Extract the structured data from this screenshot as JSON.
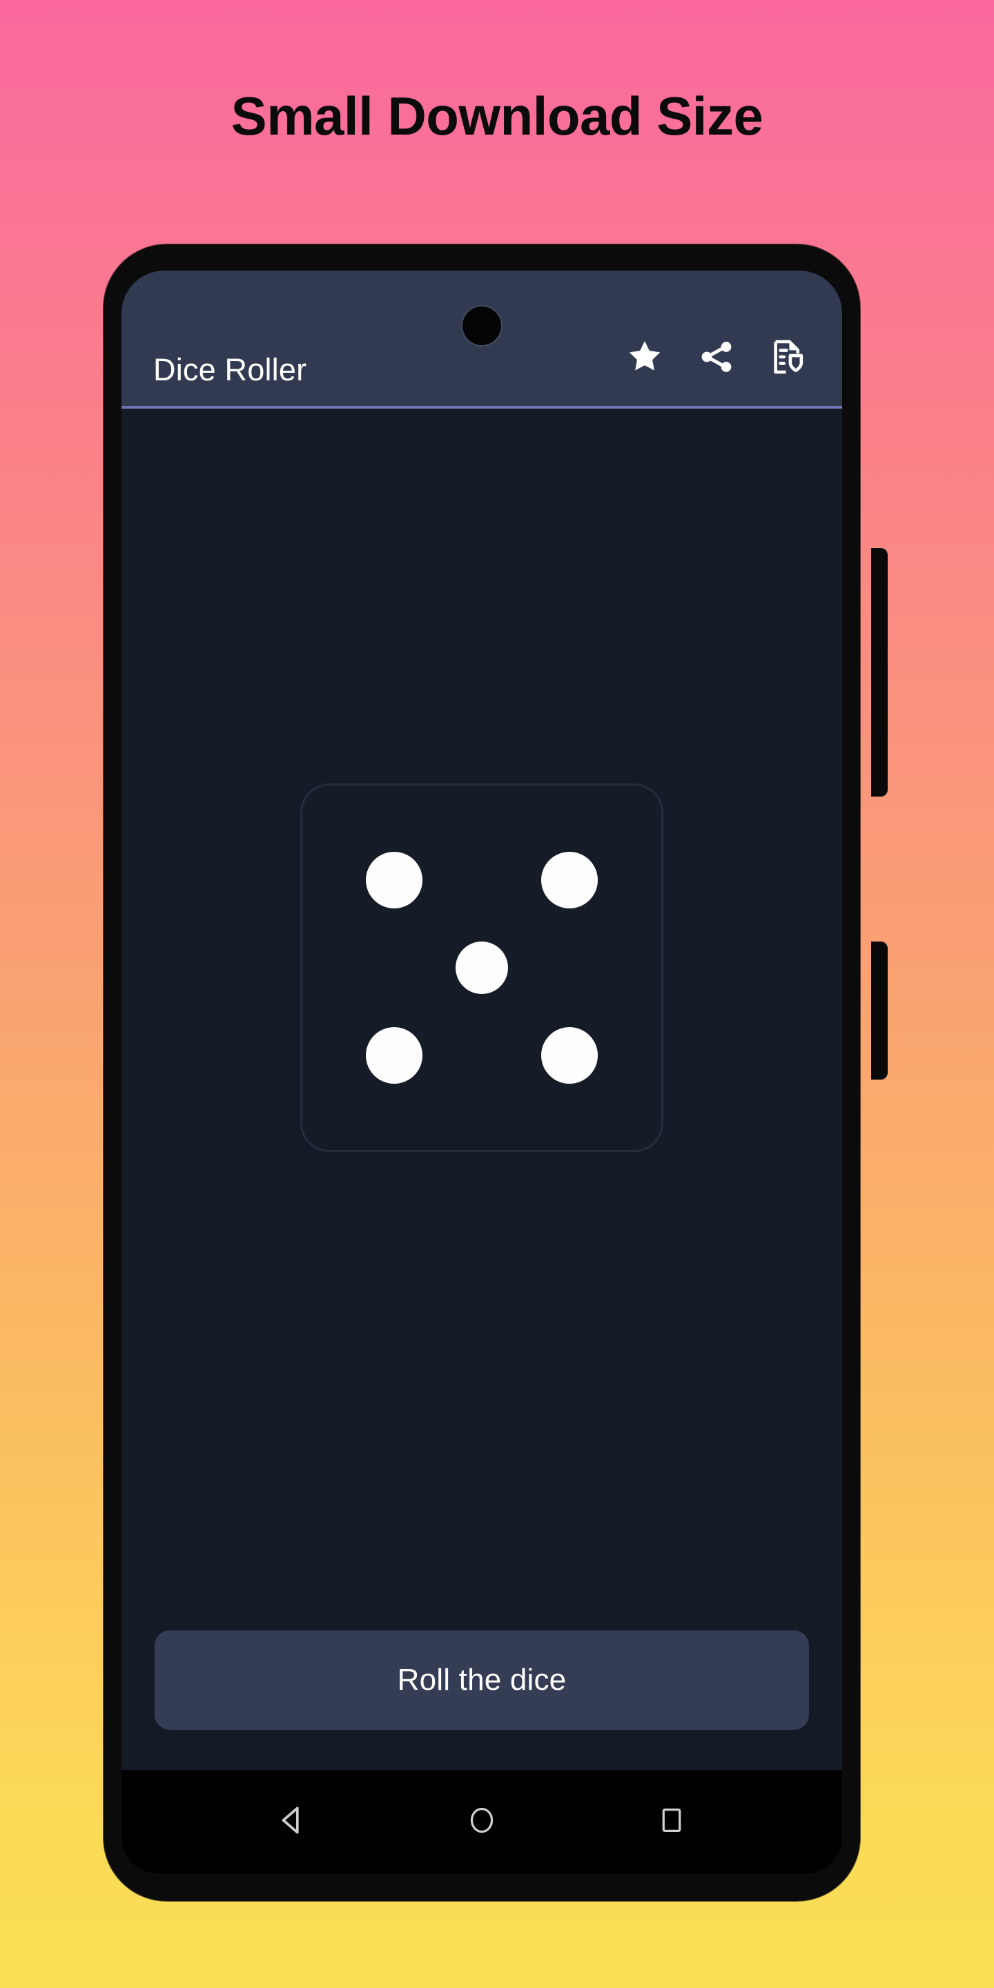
{
  "promo": {
    "headline": "Small Download Size",
    "background": {
      "gradient_from": "#fa689e",
      "gradient_mid": "#fa9e75",
      "gradient_to": "#fae055"
    }
  },
  "phone": {
    "frame_color": "#0b0b0b",
    "side_buttons": [
      {
        "name": "power-button"
      },
      {
        "name": "volume-button"
      }
    ],
    "camera": "punch-hole-camera"
  },
  "app": {
    "app_bar": {
      "title": "Dice Roller",
      "background": "#323a52",
      "accent_line": "#6d74b8",
      "actions": [
        {
          "icon": "star-icon",
          "label": "Rate"
        },
        {
          "icon": "share-icon",
          "label": "Share"
        },
        {
          "icon": "privacy-policy-icon",
          "label": "Privacy Policy"
        }
      ]
    },
    "content": {
      "background": "#151b26",
      "die": {
        "value": 5,
        "face_color": "#161c27",
        "border_color": "#252d3d",
        "pip_color": "#fdfdfd",
        "pips": [
          "tl",
          "tr",
          "c",
          "bl",
          "br"
        ]
      },
      "roll_button": {
        "label": "Roll the dice",
        "background": "#343d54",
        "text_color": "#ffffff"
      }
    },
    "nav_bar": {
      "background": "#000000",
      "keys": [
        {
          "icon": "back-icon",
          "label": "Back"
        },
        {
          "icon": "home-icon",
          "label": "Home"
        },
        {
          "icon": "recents-icon",
          "label": "Recents"
        }
      ]
    }
  }
}
